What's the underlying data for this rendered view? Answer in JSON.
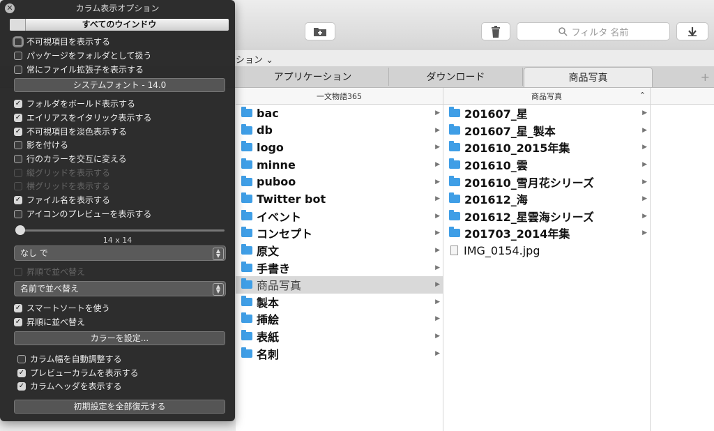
{
  "toolbar": {
    "new_folder_icon": "folder-plus-icon",
    "trash_icon": "trash-icon",
    "search_placeholder": "フィルタ 名前",
    "download_icon": "down-arrow-icon"
  },
  "pathbar": {
    "label": "ション ⌄"
  },
  "tabs": [
    {
      "label": "アプリケーション"
    },
    {
      "label": "ダウンロード"
    },
    {
      "label": "商品写真"
    }
  ],
  "tab_plus": "+",
  "columns": [
    {
      "header": "一文物語365",
      "items": [
        {
          "name": "bac"
        },
        {
          "name": "db"
        },
        {
          "name": "logo"
        },
        {
          "name": "minne"
        },
        {
          "name": "puboo"
        },
        {
          "name": "Twitter bot"
        },
        {
          "name": "イベント"
        },
        {
          "name": "コンセプト"
        },
        {
          "name": "原文"
        },
        {
          "name": "手書き"
        },
        {
          "name": "商品写真"
        },
        {
          "name": "製本"
        },
        {
          "name": "挿絵"
        },
        {
          "name": "表紙"
        },
        {
          "name": "名刺"
        }
      ]
    },
    {
      "header": "商品写真",
      "sort_indicator": "^",
      "items": [
        {
          "name": "201607_星"
        },
        {
          "name": "201607_星_製本"
        },
        {
          "name": "201610_2015年集"
        },
        {
          "name": "201610_雲"
        },
        {
          "name": "201610_雪月花シリーズ"
        },
        {
          "name": "201612_海"
        },
        {
          "name": "201612_星雲海シリーズ"
        },
        {
          "name": "201703_2014年集"
        },
        {
          "name": "IMG_0154.jpg"
        }
      ]
    }
  ],
  "panel": {
    "title": "カラム表示オプション",
    "close_icon": "close-icon",
    "scope": "すべてのウインドウ",
    "opt_hidden": "不可視項目を表示する",
    "opt_packages": "パッケージをフォルダとして扱う",
    "opt_extensions": "常にファイル拡張子を表示する",
    "font_button": "システムフォント - 14.0",
    "opt_bold_folders": "フォルダをボールド表示する",
    "opt_alias_italic": "エイリアスをイタリック表示する",
    "opt_hidden_dim": "不可視項目を淡色表示する",
    "opt_shadow": "影を付ける",
    "opt_alternate": "行のカラーを交互に変える",
    "opt_vgrid": "縦グリッドを表示する",
    "opt_hgrid": "横グリッドを表示する",
    "opt_filename": "ファイル名を表示する",
    "opt_icon_preview": "アイコンのプレビューを表示する",
    "icon_size": "14 x 14",
    "icon_size_value": 0,
    "group_by": "なし で",
    "opt_ascending_group": "昇順で並べ替え",
    "sort_by": "名前で並べ替え",
    "opt_smart_sort": "スマートソートを使う",
    "opt_ascending": "昇順に並べ替え",
    "color_button": "カラーを設定...",
    "opt_auto_width": "カラム幅を自動調整する",
    "opt_preview_column": "プレビューカラムを表示する",
    "opt_column_header": "カラムヘッダを表示する",
    "restore_button": "初期設定を全部復元する"
  }
}
